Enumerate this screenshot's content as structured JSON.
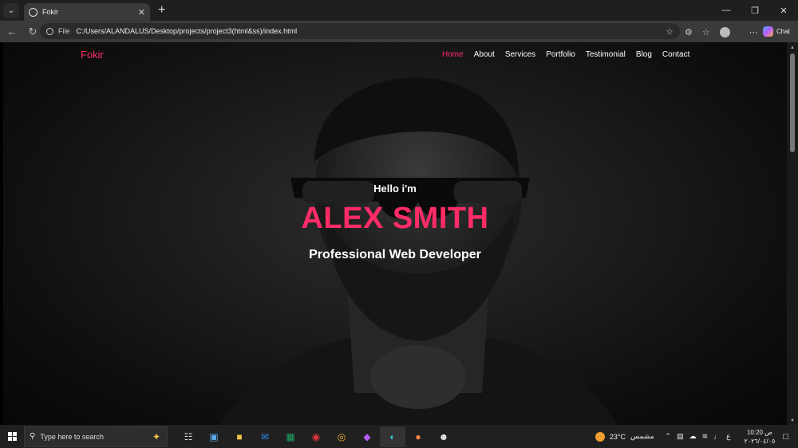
{
  "browser": {
    "tab_title": "Fokir",
    "new_tab_glyph": "+",
    "address": "C:/Users/ALANDALUS/Desktop/projects/project3(html&ss)/index.html",
    "file_chip": "File",
    "chat_label": "Chat",
    "icons": [
      "tab-menu-icon",
      "globe-icon",
      "close-icon",
      "back-icon",
      "refresh-icon",
      "info-icon",
      "star-icon",
      "extensions-icon",
      "favorites-icon",
      "profile-icon",
      "more-icon",
      "copilot-icon",
      "minimize-icon",
      "maximize-icon",
      "window-close-icon"
    ]
  },
  "site": {
    "brand": "Fokir",
    "nav": [
      {
        "label": "Home",
        "active": true
      },
      {
        "label": "About",
        "active": false
      },
      {
        "label": "Services",
        "active": false
      },
      {
        "label": "Portfolio",
        "active": false
      },
      {
        "label": "Testimonial",
        "active": false
      },
      {
        "label": "Blog",
        "active": false
      },
      {
        "label": "Contact",
        "active": false
      }
    ],
    "hero": {
      "greeting": "Hello i'm",
      "name": "ALEX SMITH",
      "role": "Professional Web Developer"
    },
    "accent_color": "#ff2c67"
  },
  "taskbar": {
    "search_placeholder": "Type here to search",
    "weather_temp": "23°C",
    "weather_text": "مشمس",
    "input_lang": "ع",
    "time": "10:20 ص",
    "date": "٢٠٢٦/٠٤/٠٥"
  }
}
